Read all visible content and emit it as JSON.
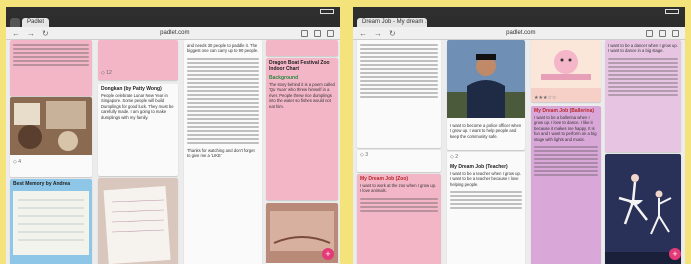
{
  "left_screen": {
    "tab_active": "Padlet",
    "tab_inactive": "",
    "url": "padlet.com",
    "cards": {
      "food_title": "Dongkan (by Patty Wong)",
      "food_body": "People celebrate Lunar New Year in Singapore. Some people will build Dumplings for good luck. They must be carefully made. I am going to make dumplings with my family.",
      "festival_title": "Dragon Boat Festival Zoo Indoor Chart",
      "festival_sub": "Background",
      "festival_body": "The story behind it is a poem called 'Qu Yuan' who threw himself in a river. People threw rice dumplings into the water so fishes would not eat him.",
      "middle_body": "and needs 30 people to paddle it. The biggest one can carry up to 90 people.",
      "middle_body2": "Thanks for watching and don't forget to give me a 'LIKE'",
      "school_title": "Best Memory by Andrea",
      "count1": "4",
      "count2": "12",
      "count3": "5"
    }
  },
  "right_screen": {
    "tab_active": "Dream Job - My dream ...",
    "url": "padlet.com",
    "cards": {
      "police_body": "I want to become a police officer when I grow up. I want to help people and keep the community safe.",
      "teacher_title": "My Dream Job (Teacher)",
      "teacher_body": "I want to be a teacher when I grow up. I want to be a teacher because I love helping people.",
      "artist_body": "I want to be a dancer when I grow up. I want to dance in a big stage.",
      "purple_title": "My Dream Job (Ballerina)",
      "purple_body": "I want to be a ballerina when I grow up. I love to dance. I like it because it makes me happy. It is fun and I want to perform on a big stage with lights and music.",
      "pink_title": "My Dream Job (Zoo)",
      "pink_body": "I want to work at the zoo when I grow up. I love animals.",
      "count1": "3",
      "count2": "2",
      "count3": "7"
    }
  },
  "colors": {
    "background": "#f4e37a",
    "pink_card": "#f3b6c7",
    "purple_card": "#d9a8d8",
    "fab": "#e43a78"
  }
}
